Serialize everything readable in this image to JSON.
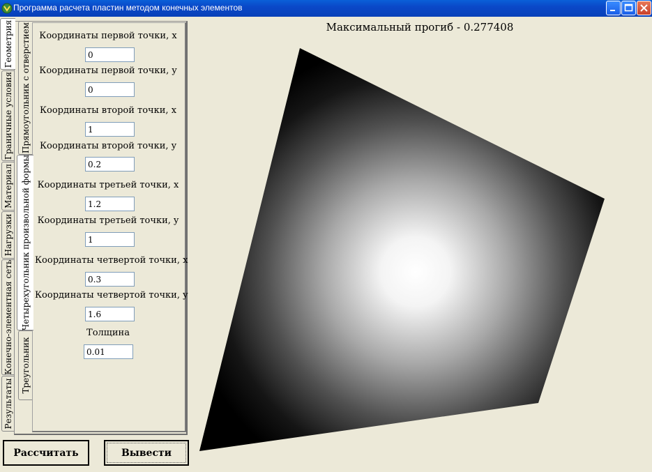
{
  "window": {
    "title": "Программа расчета пластин методом конечных элементов"
  },
  "outer_tabs": [
    "Геометрия",
    "Граничные условия",
    "Материал",
    "Нагрузки",
    "Конечно-элементная сеть",
    "Результаты"
  ],
  "inner_tabs": [
    "Прямоугольник с отверстием",
    "Четырехугольник произвольной формы",
    "Треугольник"
  ],
  "form": {
    "x1_label": "Координаты первой точки, x",
    "x1_value": "0",
    "y1_label": "Координаты первой точки, y",
    "y1_value": "0",
    "x2_label": "Координаты второй точки, x",
    "x2_value": "1",
    "y2_label": "Координаты второй точки, y",
    "y2_value": "0.2",
    "x3_label": "Координаты третьей точки, x",
    "x3_value": "1.2",
    "y3_label": "Координаты третьей точки, y",
    "y3_value": "1",
    "x4_label": "Координаты четвертой точки, x",
    "x4_value": "0.3",
    "y4_label": "Координаты четвертой точки, y",
    "y4_value": "1.6",
    "thickness_label": "Толщина",
    "thickness_value": "0.01"
  },
  "buttons": {
    "calculate": "Рассчитать",
    "output": "Вывести"
  },
  "result": {
    "max_deflection": "Максимальный прогиб - 0.277408"
  },
  "colors": {
    "titlebar": "#0a48c8",
    "background": "#ece9d8",
    "plate_center": "#ffffff",
    "plate_edge": "#000000"
  }
}
